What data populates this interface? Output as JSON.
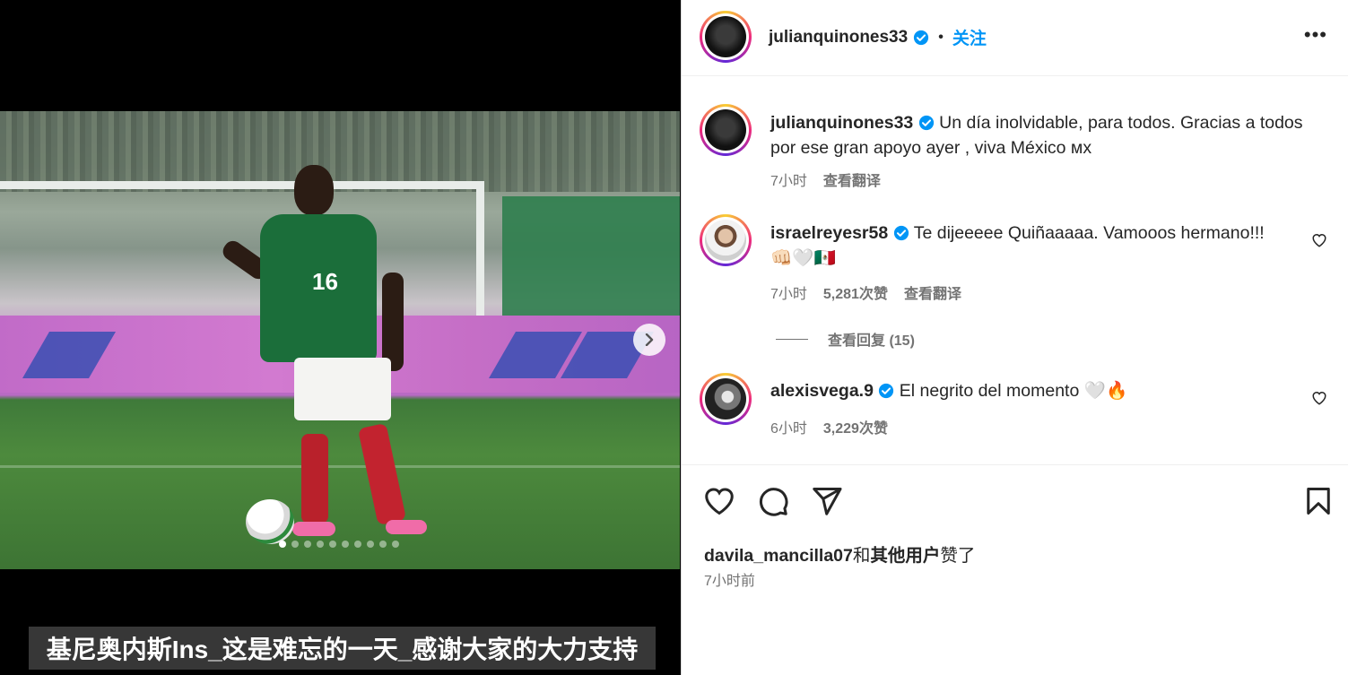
{
  "post": {
    "username": "julianquinones33",
    "follow_label": "关注",
    "more_label": "•••",
    "separator": "•"
  },
  "caption": {
    "username": "julianquinones33",
    "text": "Un día inolvidable, para todos. Gracias a todos por ese gran apoyo ayer , viva México ᴍx",
    "time": "7小时",
    "translate": "查看翻译"
  },
  "comments": [
    {
      "username": "israelreyesr58",
      "text": "Te dijeeeee Quiñaaaaa. Vamooos hermano!!!",
      "emoji": "👊🏻🤍🇲🇽",
      "time": "7小时",
      "likes": "5,281次赞",
      "translate": "查看翻译",
      "replies": "查看回复 (15)"
    },
    {
      "username": "alexisvega.9",
      "text": "El negrito del momento 🤍🔥",
      "time": "6小时",
      "likes": "3,229次赞"
    }
  ],
  "footer": {
    "liker": "davila_mancilla07",
    "liked_and": "和",
    "others": "其他用户",
    "liked_suffix": "赞了",
    "time": "7小时前"
  },
  "carousel": {
    "slides": 10,
    "active": 1
  },
  "subtitle": "基尼奥内斯Ins_这是难忘的一天_感谢大家的大力支持",
  "colors": {
    "link": "#0095f6",
    "verified": "#0095f6",
    "muted": "#737373"
  }
}
